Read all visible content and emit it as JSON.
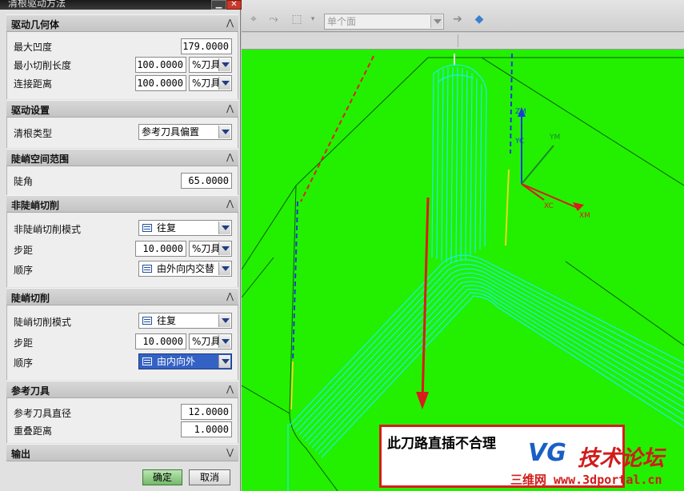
{
  "dialog": {
    "title": "清根驱动方法",
    "minimize_icon": "minimize-icon",
    "close_icon": "close-icon"
  },
  "sections": {
    "drive_geometry": {
      "title": "驱动几何体",
      "max_concavity_label": "最大凹度",
      "max_concavity_value": "179.0000",
      "min_cut_length_label": "最小切削长度",
      "min_cut_length_value": "100.0000",
      "min_cut_length_unit": "%刀具",
      "connect_distance_label": "连接距离",
      "connect_distance_value": "100.0000",
      "connect_distance_unit": "%刀具"
    },
    "drive_settings": {
      "title": "驱动设置",
      "cleanup_type_label": "清根类型",
      "cleanup_type_value": "参考刀具偏置"
    },
    "steep_range": {
      "title": "陡峭空间范围",
      "steep_angle_label": "陡角",
      "steep_angle_value": "65.0000"
    },
    "non_steep": {
      "title": "非陡峭切削",
      "pattern_label": "非陡峭切削模式",
      "pattern_value": "往复",
      "stepover_label": "步距",
      "stepover_value": "10.0000",
      "stepover_unit": "%刀具",
      "order_label": "顺序",
      "order_value": "由外向内交替"
    },
    "steep": {
      "title": "陡峭切削",
      "pattern_label": "陡峭切削模式",
      "pattern_value": "往复",
      "stepover_label": "步距",
      "stepover_value": "10.0000",
      "stepover_unit": "%刀具",
      "order_label": "顺序",
      "order_value": "由内向外"
    },
    "reference_tool": {
      "title": "参考刀具",
      "diameter_label": "参考刀具直径",
      "diameter_value": "12.0000",
      "overlap_label": "重叠距离",
      "overlap_value": "1.0000"
    },
    "output": {
      "title": "输出"
    }
  },
  "buttons": {
    "ok": "确定",
    "cancel": "取消"
  },
  "toolbar": {
    "filter_value": "单个面"
  },
  "viewport": {
    "annotation": "此刀路直插不合理",
    "logo_vg": "VG",
    "logo_cn": "技术论坛",
    "logo_url": "三维网 www.3dportal.cn",
    "axis_labels": [
      "ZM",
      "YC",
      "XC",
      "YM",
      "XM"
    ]
  },
  "colors": {
    "background_green": "#22f000",
    "toolpath_cyan": "#19f0e4",
    "annotation_red": "#d81c1c"
  }
}
